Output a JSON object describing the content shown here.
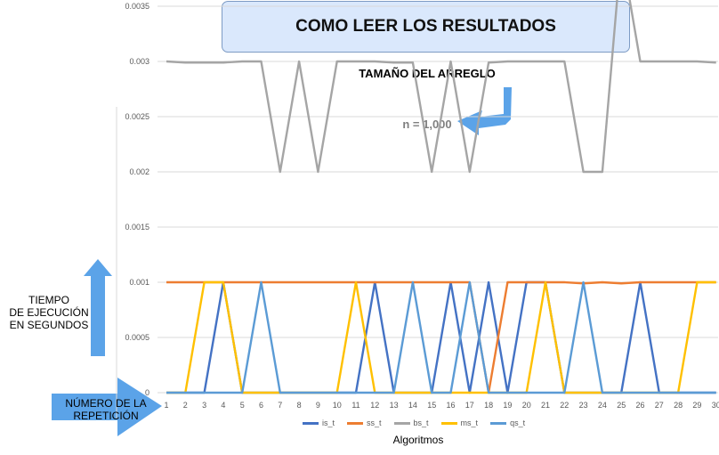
{
  "header": {
    "title": "COMO LEER LOS RESULTADOS"
  },
  "annotations": {
    "array_size_label": "TAMAÑO DEL ARREGLO",
    "n_label": "n = 1,000",
    "time_label_lines": [
      "TIEMPO",
      "DE EJECUCIÓN",
      "EN SEGUNDOS"
    ],
    "repetition_label_lines": [
      "NÚMERO DE LA",
      "REPETICIÓN"
    ]
  },
  "chart_data": {
    "type": "line",
    "title": "n = 1,000",
    "xlabel": "Algoritmos",
    "ylabel": "",
    "x": [
      1,
      2,
      3,
      4,
      5,
      6,
      7,
      8,
      9,
      10,
      11,
      12,
      13,
      14,
      15,
      16,
      17,
      18,
      19,
      20,
      21,
      22,
      23,
      24,
      25,
      26,
      27,
      28,
      29,
      30
    ],
    "ylim": [
      0,
      0.0045
    ],
    "yticks": [
      "0",
      "0.0005",
      "0.001",
      "0.0015",
      "0.002",
      "0.0025",
      "0.003",
      "0.0035",
      "0.004",
      "0.0045"
    ],
    "grid": true,
    "legend_position": "bottom",
    "series": [
      {
        "name": "is_t",
        "color": "#4472c4",
        "values": [
          0,
          0,
          0,
          0.001,
          0,
          0,
          0,
          0,
          0,
          0,
          0,
          0.001,
          0,
          0,
          0,
          0.001,
          0,
          0.001,
          0,
          0.001,
          0.001,
          0,
          0,
          0,
          0,
          0.001,
          0,
          0,
          0,
          0
        ]
      },
      {
        "name": "ss_t",
        "color": "#ed7d31",
        "values": [
          0.001,
          0.001,
          0.001,
          0.001,
          0.001,
          0.001,
          0.001,
          0.001,
          0.001,
          0.001,
          0.001,
          0.001,
          0.001,
          0.001,
          0.001,
          0.001,
          0.001,
          0,
          0.001,
          0.001,
          0.001,
          0.001,
          0.00099,
          0.001,
          0.00099,
          0.001,
          0.001,
          0.001,
          0.001,
          0.001
        ]
      },
      {
        "name": "bs_t",
        "color": "#a5a5a5",
        "values": [
          0.003,
          0.00299,
          0.00299,
          0.00299,
          0.003,
          0.003,
          0.002,
          0.003,
          0.002,
          0.003,
          0.003,
          0.003,
          0.00299,
          0.00299,
          0.002,
          0.003,
          0.002,
          0.00299,
          0.003,
          0.003,
          0.003,
          0.003,
          0.002,
          0.002,
          0.004,
          0.003,
          0.003,
          0.003,
          0.003,
          0.00299
        ]
      },
      {
        "name": "ms_t",
        "color": "#ffc000",
        "values": [
          0,
          0,
          0.001,
          0.001,
          0,
          0,
          0,
          0,
          0,
          0,
          0.001,
          0,
          0,
          0,
          0,
          0,
          0,
          0,
          0,
          0,
          0.001,
          0,
          0,
          0,
          0,
          0,
          0,
          0,
          0.001,
          0.001
        ]
      },
      {
        "name": "qs_t",
        "color": "#5b9bd5",
        "values": [
          0,
          0,
          0,
          0,
          0,
          0.001,
          0,
          0,
          0,
          0,
          0,
          0,
          0,
          0.001,
          0,
          0,
          0.001,
          0,
          0,
          0,
          0,
          0,
          0.001,
          0,
          0,
          0,
          0,
          0,
          0,
          0
        ]
      }
    ]
  }
}
